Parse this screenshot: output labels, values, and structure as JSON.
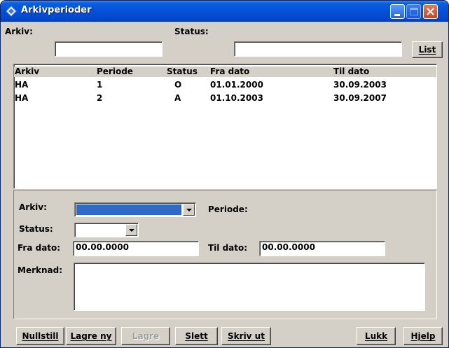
{
  "window": {
    "title": "Arkivperioder",
    "icons": {
      "app": "diamond-app-icon",
      "minimize": "minimize-icon",
      "maximize": "maximize-icon",
      "close": "close-icon"
    }
  },
  "filter": {
    "arkiv_label": "Arkiv:",
    "arkiv_value": "",
    "status_label": "Status:",
    "status_value": "",
    "list_button": "List"
  },
  "list": {
    "columns": [
      "Arkiv",
      "Periode",
      "Status",
      "Fra dato",
      "Til dato"
    ],
    "rows": [
      [
        "HA",
        "1",
        "O",
        "01.01.2000",
        "30.09.2003"
      ],
      [
        "HA",
        "2",
        "A",
        "01.10.2003",
        "30.09.2007"
      ]
    ]
  },
  "detail": {
    "arkiv_label": "Arkiv:",
    "periode_label": "Periode:",
    "status_label": "Status:",
    "fra_dato_label": "Fra dato:",
    "fra_dato_value": "00.00.0000",
    "til_dato_label": "Til dato:",
    "til_dato_value": "00.00.0000",
    "merknad_label": "Merknad:",
    "merknad_value": ""
  },
  "buttons": {
    "nullstill": "Nullstill",
    "lagre_ny": "Lagre ny",
    "lagre": "Lagre",
    "slett": "Slett",
    "skriv_ut": "Skriv ut",
    "lukk": "Lukk",
    "hjelp": "Hjelp"
  },
  "colors": {
    "title_bar": "#0450d8",
    "face": "#d4d0c8",
    "selection": "#316ac5"
  }
}
